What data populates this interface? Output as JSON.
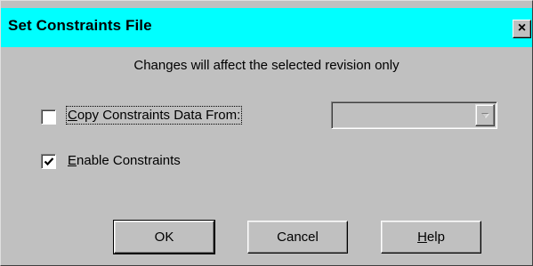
{
  "dialog": {
    "title": "Set Constraints File",
    "close_glyph": "×",
    "message": "Changes will affect the selected revision only"
  },
  "options": {
    "copy_constraints": {
      "checked": false,
      "label_prefix": "C",
      "label_rest": "opy Constraints Data From:"
    },
    "enable_constraints": {
      "checked": true,
      "label_prefix": "E",
      "label_rest": "nable Constraints"
    },
    "copy_source_select": {
      "value": "",
      "disabled": true
    }
  },
  "buttons": {
    "ok": "OK",
    "cancel": "Cancel",
    "help_prefix": "H",
    "help_rest": "elp"
  },
  "colors": {
    "titlebar": "#00ffff",
    "face": "#c0c0c0"
  }
}
